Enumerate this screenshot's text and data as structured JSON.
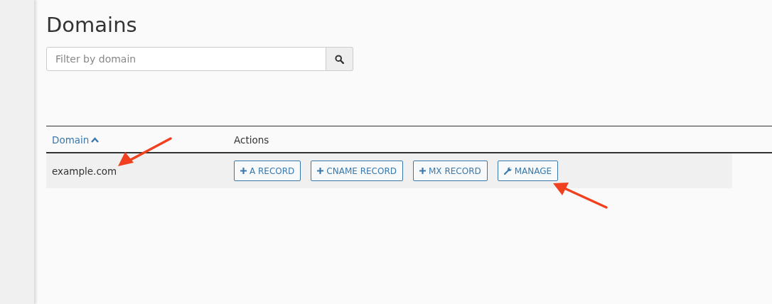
{
  "page": {
    "title": "Domains"
  },
  "search": {
    "placeholder": "Filter by domain"
  },
  "table": {
    "columns": [
      {
        "label": "Domain",
        "sorted": true
      },
      {
        "label": "Actions",
        "sorted": false
      }
    ],
    "rows": [
      {
        "domain": "example.com",
        "actions": [
          {
            "label": "A RECORD",
            "kind": "add"
          },
          {
            "label": "CNAME RECORD",
            "kind": "add"
          },
          {
            "label": "MX RECORD",
            "kind": "add"
          },
          {
            "label": "MANAGE",
            "kind": "manage"
          }
        ]
      }
    ]
  }
}
